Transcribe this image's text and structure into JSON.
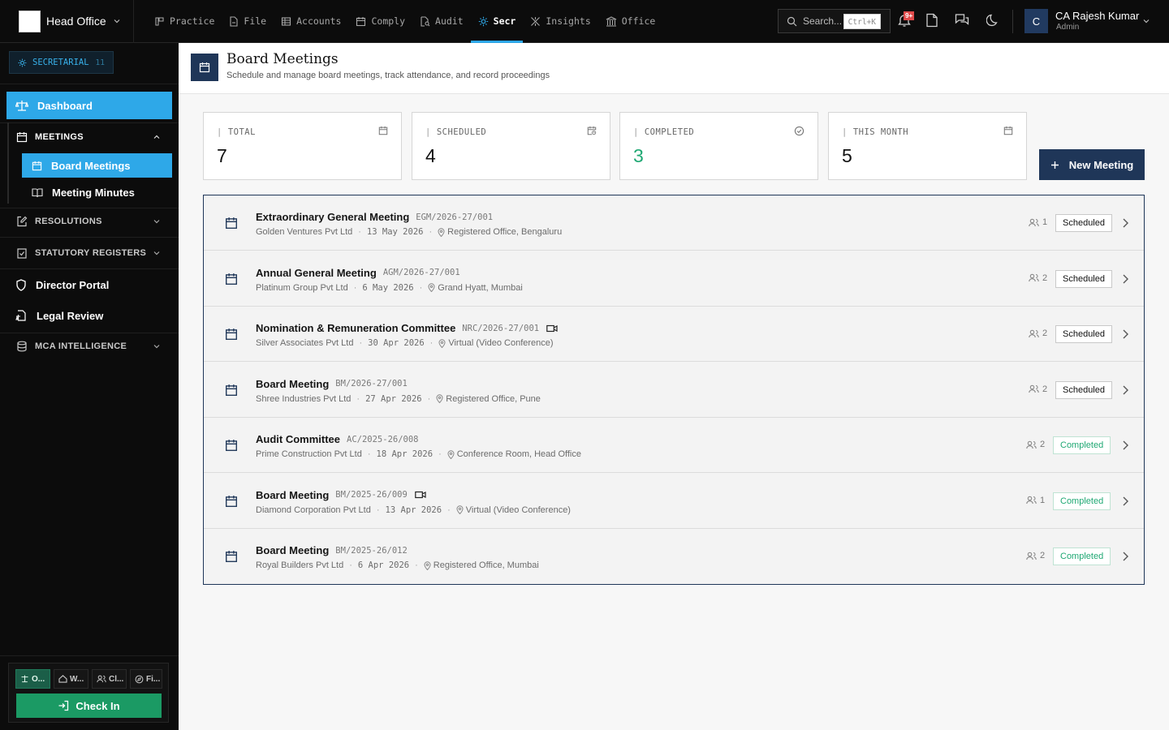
{
  "topbar": {
    "office": "Head Office",
    "nav": [
      {
        "label": "Practice",
        "icon": "practice-icon"
      },
      {
        "label": "File",
        "icon": "file-icon"
      },
      {
        "label": "Accounts",
        "icon": "accounts-icon"
      },
      {
        "label": "Comply",
        "icon": "comply-icon"
      },
      {
        "label": "Audit",
        "icon": "audit-icon"
      },
      {
        "label": "Secr",
        "icon": "sun-icon",
        "active": true
      },
      {
        "label": "Insights",
        "icon": "insights-icon"
      },
      {
        "label": "Office",
        "icon": "office-icon"
      }
    ],
    "search_placeholder": "Search...",
    "search_shortcut": "Ctrl+K",
    "notifications_badge": "9+",
    "avatar_initial": "C",
    "user_name": "CA Rajesh Kumar",
    "user_role": "Admin",
    "accent": "#2ea8e8"
  },
  "sidebar": {
    "module": {
      "label": "SECRETARIAL",
      "count": "11"
    },
    "dashboard": "Dashboard",
    "meetings_group": "MEETINGS",
    "meetings_items": [
      "Board Meetings",
      "Meeting Minutes"
    ],
    "resolutions_group": "RESOLUTIONS",
    "registers_group": "STATUTORY REGISTERS",
    "director_portal": "Director Portal",
    "legal_review": "Legal Review",
    "mca_group": "MCA INTELLIGENCE",
    "quick_links": [
      "O...",
      "W...",
      "Cl...",
      "Fi..."
    ],
    "check_in": "Check In"
  },
  "page": {
    "title": "Board Meetings",
    "subtitle": "Schedule and manage board meetings, track attendance, and record proceedings"
  },
  "stats": [
    {
      "label": "TOTAL",
      "value": "7",
      "icon": "calendar-icon"
    },
    {
      "label": "SCHEDULED",
      "value": "4",
      "icon": "calendar-clock-icon"
    },
    {
      "label": "COMPLETED",
      "value": "3",
      "icon": "check-circle-icon"
    },
    {
      "label": "THIS MONTH",
      "value": "5",
      "icon": "calendar-icon"
    }
  ],
  "new_meeting_label": "New Meeting",
  "meetings": [
    {
      "title": "Extraordinary General Meeting",
      "code": "EGM/2026-27/001",
      "video": false,
      "company": "Golden Ventures Pvt Ltd",
      "date": "13 May 2026",
      "location": "Registered Office, Bengaluru",
      "attendees": "1",
      "status": "Scheduled"
    },
    {
      "title": "Annual General Meeting",
      "code": "AGM/2026-27/001",
      "video": false,
      "company": "Platinum Group Pvt Ltd",
      "date": "6 May 2026",
      "location": "Grand Hyatt, Mumbai",
      "attendees": "2",
      "status": "Scheduled"
    },
    {
      "title": "Nomination & Remuneration Committee",
      "code": "NRC/2026-27/001",
      "video": true,
      "company": "Silver Associates Pvt Ltd",
      "date": "30 Apr 2026",
      "location": "Virtual (Video Conference)",
      "attendees": "2",
      "status": "Scheduled"
    },
    {
      "title": "Board Meeting",
      "code": "BM/2026-27/001",
      "video": false,
      "company": "Shree Industries Pvt Ltd",
      "date": "27 Apr 2026",
      "location": "Registered Office, Pune",
      "attendees": "2",
      "status": "Scheduled"
    },
    {
      "title": "Audit Committee",
      "code": "AC/2025-26/008",
      "video": false,
      "company": "Prime Construction Pvt Ltd",
      "date": "18 Apr 2026",
      "location": "Conference Room, Head Office",
      "attendees": "2",
      "status": "Completed"
    },
    {
      "title": "Board Meeting",
      "code": "BM/2025-26/009",
      "video": true,
      "company": "Diamond Corporation Pvt Ltd",
      "date": "13 Apr 2026",
      "location": "Virtual (Video Conference)",
      "attendees": "1",
      "status": "Completed"
    },
    {
      "title": "Board Meeting",
      "code": "BM/2025-26/012",
      "video": false,
      "company": "Royal Builders Pvt Ltd",
      "date": "6 Apr 2026",
      "location": "Registered Office, Mumbai",
      "attendees": "2",
      "status": "Completed"
    }
  ]
}
